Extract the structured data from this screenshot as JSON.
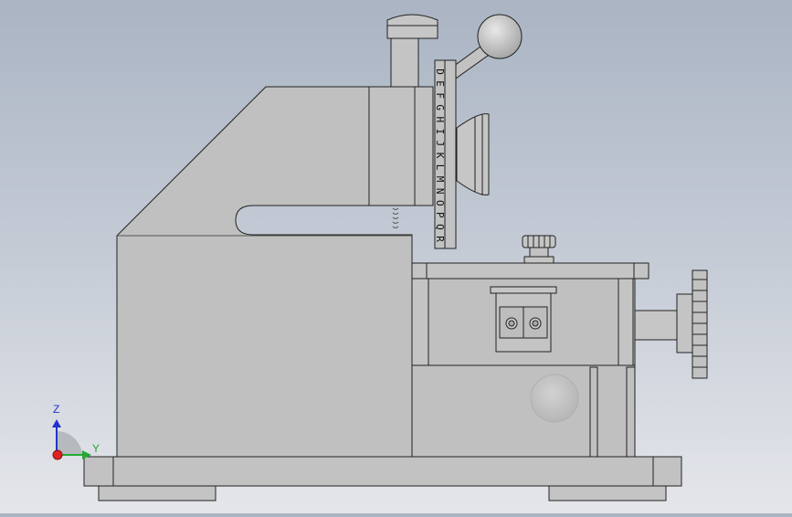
{
  "viewport": {
    "background_top": "#aab4c3",
    "background_bottom": "#e4e6ea",
    "part_fill": "#c0c0c0",
    "edge_color": "#222222"
  },
  "wheel": {
    "letters": [
      "D",
      "E",
      "F",
      "G",
      "H",
      "I",
      "J",
      "K",
      "L",
      "M",
      "N",
      "O",
      "P",
      "Q",
      "R"
    ]
  },
  "triad": {
    "z_label": "Z",
    "y_label": "Y",
    "z_color": "#2233cc",
    "y_color": "#22aa33",
    "x_color": "#dd2222"
  }
}
